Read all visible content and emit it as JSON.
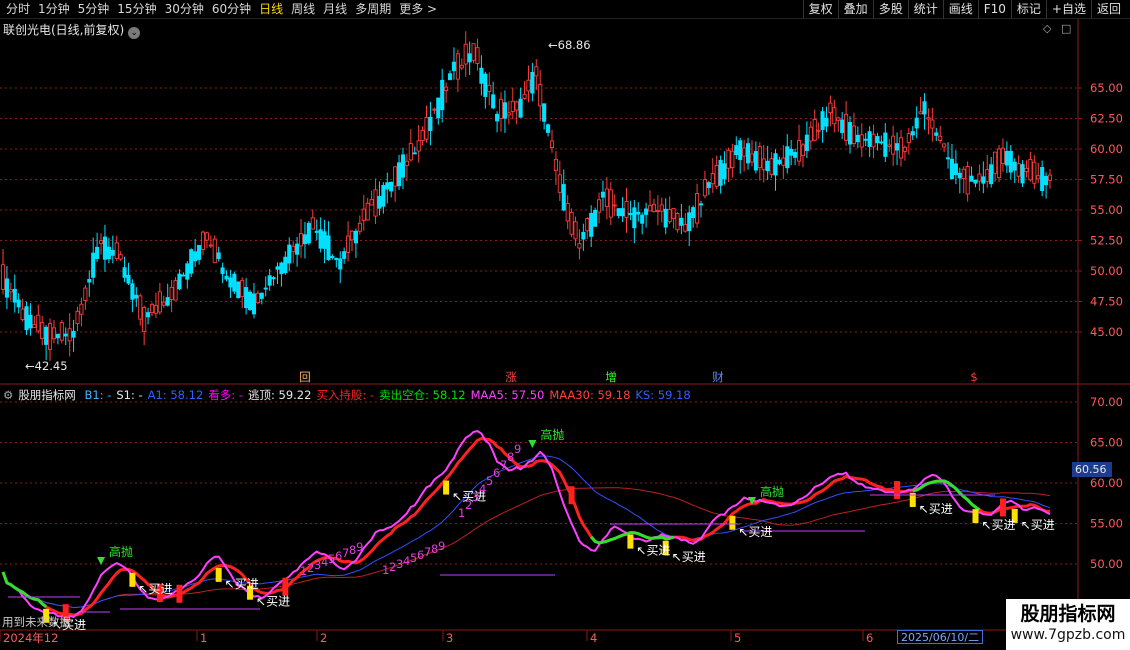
{
  "toolbar": {
    "periods": [
      "分时",
      "1分钟",
      "5分钟",
      "15分钟",
      "30分钟",
      "60分钟",
      "日线",
      "周线",
      "月线",
      "多周期",
      "更多 >"
    ],
    "active_period": "日线",
    "actions": [
      "复权",
      "叠加",
      "多股",
      "统计",
      "画线",
      "F10",
      "标记",
      "+自选",
      "返回"
    ]
  },
  "main_chart": {
    "title": "联创光电(日线,前复权)",
    "high_label": "68.86",
    "low_label": "42.45",
    "y_axis": [
      "65.00",
      "62.50",
      "60.00",
      "57.50",
      "55.00",
      "52.50",
      "50.00",
      "47.50",
      "45.00"
    ],
    "event_markers": [
      "回",
      "涨",
      "增",
      "财",
      "$"
    ],
    "colors": {
      "up": "#ff3b3b",
      "down": "#00e0ff",
      "grid": "#8b1a1a",
      "axis_text": "#ff5a5a"
    }
  },
  "indicator": {
    "name": "股朋指标网",
    "fields": [
      {
        "label": "B1: -",
        "color": "#3cb4ff"
      },
      {
        "label": "S1: -",
        "color": "#e6e6e6"
      },
      {
        "label": "A1: 58.12",
        "color": "#3060ff"
      },
      {
        "label": "看多: -",
        "color": "#ff00ff"
      },
      {
        "label": "逃顶: 59.22",
        "color": "#e6e6e6"
      },
      {
        "label": "买入持股: -",
        "color": "#ff2020"
      },
      {
        "label": "卖出空仓: 58.12",
        "color": "#00e000"
      },
      {
        "label": "MAA5: 57.50",
        "color": "#ff40ff"
      },
      {
        "label": "MAA30: 59.18",
        "color": "#ff4040"
      },
      {
        "label": "KS: 59.18",
        "color": "#3060ff"
      }
    ],
    "y_axis": [
      "70.00",
      "65.00",
      "60.00",
      "55.00",
      "50.00"
    ],
    "current_value": "60.56",
    "signals": {
      "buy": "买进",
      "sell": "高抛",
      "buy_counts": [
        "1",
        "2",
        "3",
        "4",
        "5",
        "6",
        "7",
        "8",
        "9"
      ]
    }
  },
  "time_axis": [
    "2024年12",
    "1",
    "2",
    "3",
    "4",
    "5",
    "6"
  ],
  "date_badge": "2025/06/10/二",
  "footer_note": "用到未来数据",
  "watermark": {
    "name": "股朋指标网",
    "url": "www.7gpzb.com"
  }
}
